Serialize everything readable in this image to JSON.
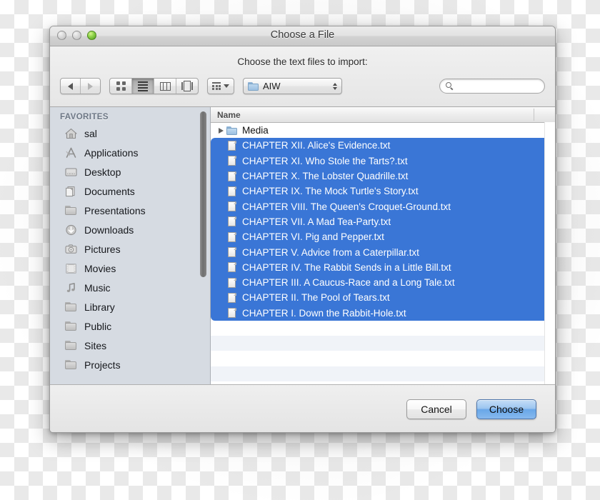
{
  "window": {
    "title": "Choose a File",
    "traffic": {
      "close": "close-button",
      "minimize": "minimize-button",
      "zoom": "zoom-button"
    }
  },
  "toolbar": {
    "prompt": "Choose the text files to import:",
    "nav": {
      "back": "back-arrow-icon",
      "forward": "forward-arrow-icon"
    },
    "view_modes": [
      {
        "name": "icon-view",
        "selected": false
      },
      {
        "name": "list-view",
        "selected": true
      },
      {
        "name": "column-view",
        "selected": false
      },
      {
        "name": "coverflow-view",
        "selected": false
      }
    ],
    "arrange": {
      "icon": "arrange-grid-icon",
      "caret": "chevron-down-icon"
    },
    "path_popup": {
      "label": "AIW",
      "icon": "blue-folder-icon"
    },
    "search": {
      "value": "",
      "placeholder": "",
      "icon": "search-icon"
    }
  },
  "sidebar": {
    "header": "FAVORITES",
    "items": [
      {
        "label": "sal",
        "icon": "home-icon"
      },
      {
        "label": "Applications",
        "icon": "applications-icon"
      },
      {
        "label": "Desktop",
        "icon": "desktop-icon"
      },
      {
        "label": "Documents",
        "icon": "documents-icon"
      },
      {
        "label": "Presentations",
        "icon": "folder-icon"
      },
      {
        "label": "Downloads",
        "icon": "downloads-icon"
      },
      {
        "label": "Pictures",
        "icon": "pictures-icon"
      },
      {
        "label": "Movies",
        "icon": "movies-icon"
      },
      {
        "label": "Music",
        "icon": "music-icon"
      },
      {
        "label": "Library",
        "icon": "folder-icon"
      },
      {
        "label": "Public",
        "icon": "folder-icon"
      },
      {
        "label": "Sites",
        "icon": "folder-icon"
      },
      {
        "label": "Projects",
        "icon": "folder-icon"
      }
    ]
  },
  "file_list": {
    "column_header": "Name",
    "rows": [
      {
        "name": "Media",
        "type": "folder",
        "selected": false,
        "expandable": true
      },
      {
        "name": "CHAPTER XII. Alice's Evidence.txt",
        "type": "file",
        "selected": true
      },
      {
        "name": "CHAPTER XI. Who Stole the Tarts?.txt",
        "type": "file",
        "selected": true
      },
      {
        "name": "CHAPTER X. The Lobster Quadrille.txt",
        "type": "file",
        "selected": true
      },
      {
        "name": "CHAPTER IX. The Mock Turtle's Story.txt",
        "type": "file",
        "selected": true
      },
      {
        "name": "CHAPTER VIII. The Queen's Croquet-Ground.txt",
        "type": "file",
        "selected": true
      },
      {
        "name": "CHAPTER VII. A Mad Tea-Party.txt",
        "type": "file",
        "selected": true
      },
      {
        "name": "CHAPTER VI. Pig and Pepper.txt",
        "type": "file",
        "selected": true
      },
      {
        "name": "CHAPTER V. Advice from a Caterpillar.txt",
        "type": "file",
        "selected": true
      },
      {
        "name": "CHAPTER IV. The Rabbit Sends in a Little Bill.txt",
        "type": "file",
        "selected": true
      },
      {
        "name": "CHAPTER III. A Caucus-Race and a Long Tale.txt",
        "type": "file",
        "selected": true
      },
      {
        "name": "CHAPTER II. The Pool of Tears.txt",
        "type": "file",
        "selected": true
      },
      {
        "name": "CHAPTER I. Down the Rabbit-Hole.txt",
        "type": "file",
        "selected": true
      }
    ]
  },
  "footer": {
    "cancel_label": "Cancel",
    "choose_label": "Choose"
  },
  "colors": {
    "selection_blue": "#3a76d6",
    "sidebar_bg": "#d6dbe2",
    "default_button_blue": "#69a7e8",
    "zoom_green": "#8ed24a"
  }
}
